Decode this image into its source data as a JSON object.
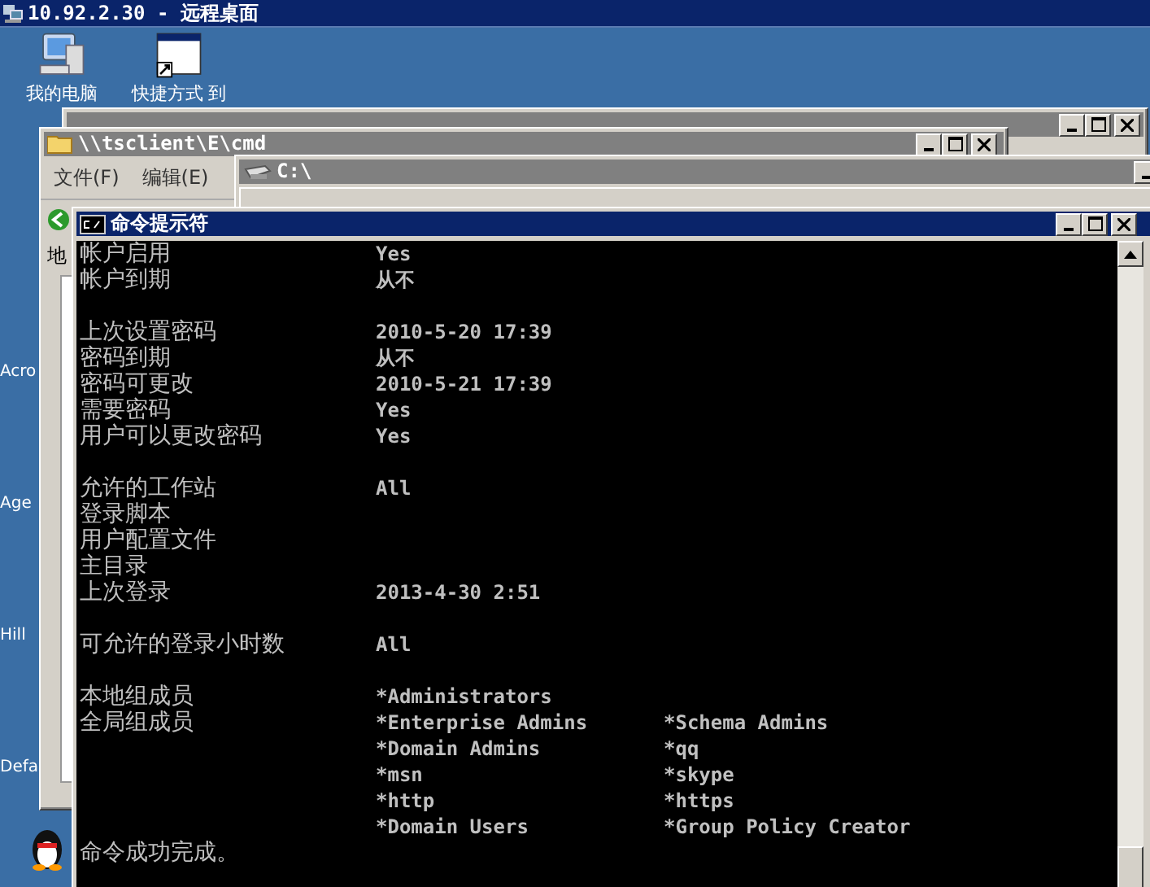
{
  "remote_desktop": {
    "title": "10.92.2.30 - 远程桌面"
  },
  "desktop_icons": [
    {
      "kind": "computer",
      "label": "我的电脑"
    },
    {
      "kind": "shortcut",
      "label": "快捷方式 到"
    }
  ],
  "side_labels": [
    "Acro",
    "Age",
    "Hill",
    "Defa"
  ],
  "explorer_window": {
    "title": "\\\\tsclient\\E\\cmd",
    "menu": [
      "文件(F)",
      "编辑(E)"
    ],
    "address_tab": "地"
  },
  "drive_window": {
    "title": "C:\\"
  },
  "cmd_window": {
    "title": "命令提示符",
    "lines": [
      {
        "kind": "text",
        "label": "帐户启用",
        "value": "Yes"
      },
      {
        "kind": "text",
        "label": "帐户到期",
        "value": "从不"
      },
      {
        "kind": "blank"
      },
      {
        "kind": "text",
        "label": "上次设置密码",
        "value": "2010-5-20 17:39"
      },
      {
        "kind": "text",
        "label": "密码到期",
        "value": "从不"
      },
      {
        "kind": "text",
        "label": "密码可更改",
        "value": "2010-5-21 17:39"
      },
      {
        "kind": "text",
        "label": "需要密码",
        "value": "Yes"
      },
      {
        "kind": "text",
        "label": "用户可以更改密码",
        "value": "Yes"
      },
      {
        "kind": "blank"
      },
      {
        "kind": "text",
        "label": "允许的工作站",
        "value": "All"
      },
      {
        "kind": "text",
        "label": "登录脚本"
      },
      {
        "kind": "text",
        "label": "用户配置文件"
      },
      {
        "kind": "text",
        "label": "主目录"
      },
      {
        "kind": "text",
        "label": "上次登录",
        "value": "2013-4-30 2:51"
      },
      {
        "kind": "blank"
      },
      {
        "kind": "text",
        "label": "可允许的登录小时数",
        "value": "All"
      },
      {
        "kind": "blank"
      },
      {
        "kind": "text",
        "label": "本地组成员",
        "value": "*Administrators"
      },
      {
        "kind": "text",
        "label": "全局组成员",
        "value": "*Enterprise Admins",
        "value_2": "*Schema Admins"
      },
      {
        "kind": "text",
        "value": "*Domain Admins",
        "value_2": "*qq"
      },
      {
        "kind": "text",
        "value": "*msn",
        "value_2": "*skype"
      },
      {
        "kind": "text",
        "value": "*http",
        "value_2": "*https"
      },
      {
        "kind": "text",
        "value": "*Domain Users",
        "value_2": "*Group Policy Creator"
      },
      {
        "kind": "text",
        "label": "命令成功完成。"
      }
    ]
  }
}
